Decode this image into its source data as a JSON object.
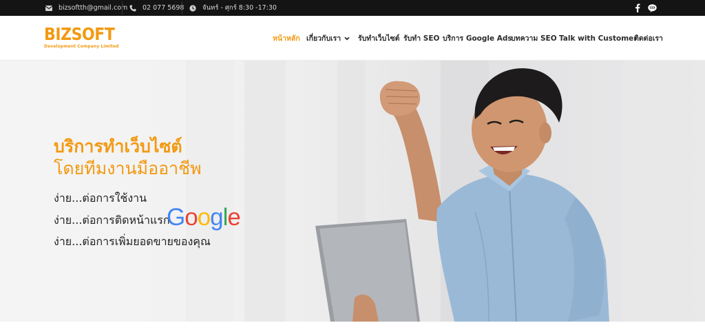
{
  "topbar": {
    "email": "bizsoftth@gmail.com",
    "phone": "02 077 5698",
    "hours": "จันทร์ - ศุกร์  8:30 -17:30",
    "social": [
      "facebook-icon",
      "line-icon"
    ]
  },
  "header": {
    "logo": {
      "name": "BIZSOFT",
      "tagline": "Development Company Limited"
    },
    "nav": [
      {
        "label": "หน้าหลัก",
        "active": true
      },
      {
        "label": "เกี่ยวกับเรา",
        "dropdown": true
      },
      {
        "label": "รับทำเว็บไซต์"
      },
      {
        "label": "รับทำ SEO"
      },
      {
        "label": "บริการ Google Ads"
      },
      {
        "label": "บทความ SEO"
      },
      {
        "label": "Talk with Customer"
      },
      {
        "label": "ติดต่อเรา"
      }
    ]
  },
  "hero": {
    "title_line1": "บริการทำเว็บไซต์",
    "title_line2": "โดยทีมงานมืออาชีพ",
    "lines": [
      "ง่าย...ต่อการใช้งาน",
      "ง่าย...ต่อการติดหน้าแรก",
      "ง่าย...ต่อการเพิ่มยอดขายของคุณ"
    ],
    "google_logo": "Google"
  },
  "colors": {
    "accent": "#f29a12",
    "topbar_bg": "#141414",
    "google_blue": "#4285f4",
    "google_red": "#ea4335",
    "google_yellow": "#fbbc05",
    "google_green": "#34a853"
  }
}
